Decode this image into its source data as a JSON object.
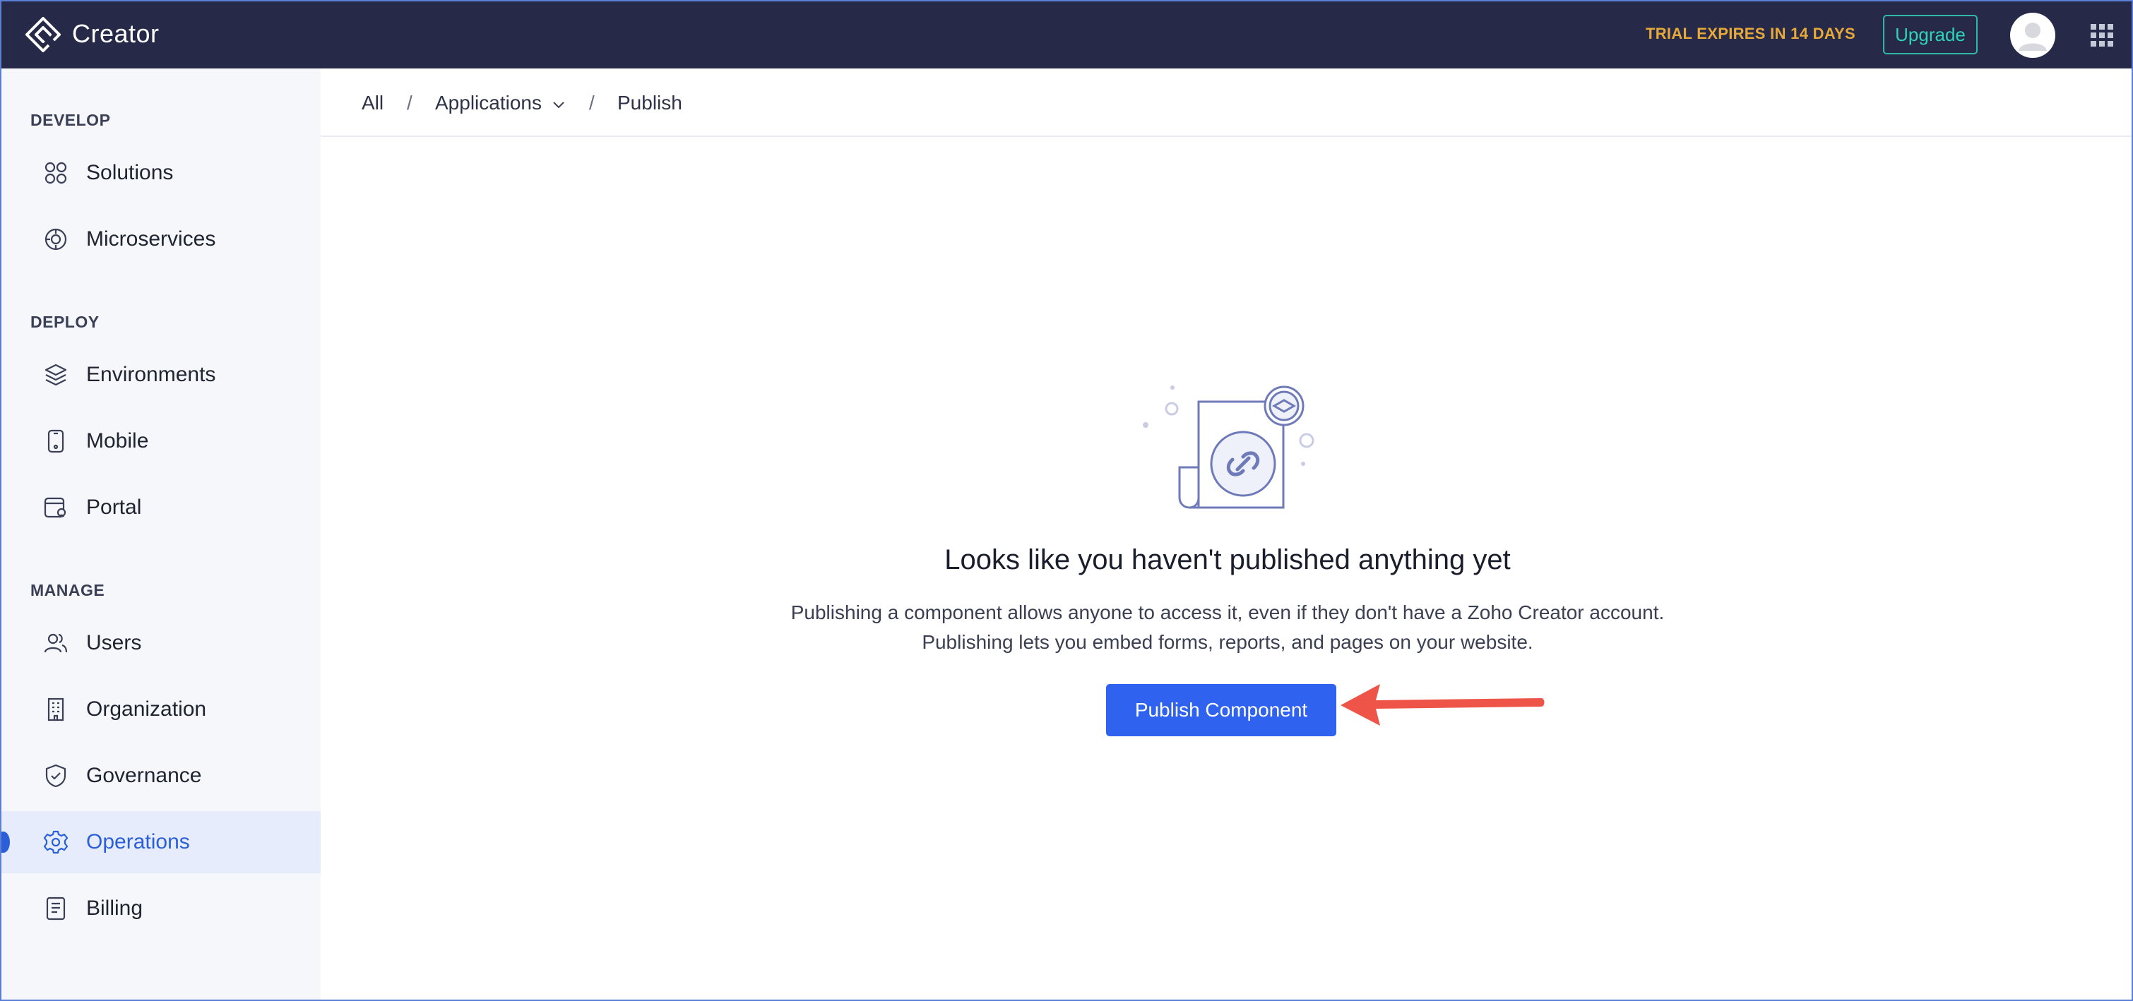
{
  "header": {
    "app_title": "Creator",
    "trial_text": "TRIAL EXPIRES IN 14 DAYS",
    "upgrade_label": "Upgrade",
    "colors": {
      "bar": "#262a48",
      "trial": "#e6a93a",
      "upgrade": "#2fd3b6"
    }
  },
  "sidebar": {
    "sections": [
      {
        "title": "DEVELOP",
        "items": [
          {
            "label": "Solutions",
            "icon": "solutions-icon"
          },
          {
            "label": "Microservices",
            "icon": "microservices-icon"
          }
        ]
      },
      {
        "title": "DEPLOY",
        "items": [
          {
            "label": "Environments",
            "icon": "layers-icon"
          },
          {
            "label": "Mobile",
            "icon": "mobile-icon"
          },
          {
            "label": "Portal",
            "icon": "portal-icon"
          }
        ]
      },
      {
        "title": "MANAGE",
        "items": [
          {
            "label": "Users",
            "icon": "users-icon"
          },
          {
            "label": "Organization",
            "icon": "building-icon"
          },
          {
            "label": "Governance",
            "icon": "shield-icon"
          },
          {
            "label": "Operations",
            "icon": "gear-icon",
            "active": true
          },
          {
            "label": "Billing",
            "icon": "billing-icon"
          }
        ]
      }
    ]
  },
  "breadcrumb": {
    "all": "All",
    "applications": "Applications",
    "current": "Publish",
    "separator": "/"
  },
  "empty_state": {
    "title": "Looks like you haven't published anything yet",
    "line1": "Publishing a component allows anyone to access it, even if they don't have a Zoho Creator account.",
    "line2": "Publishing lets you embed forms, reports, and pages on your website.",
    "button_label": "Publish Component",
    "colors": {
      "button": "#2f62ee",
      "arrow": "#ee5448"
    }
  }
}
